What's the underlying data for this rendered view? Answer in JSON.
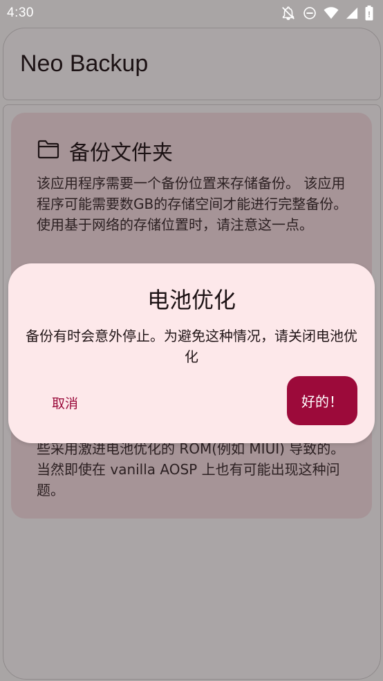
{
  "status_bar": {
    "time": "4:30",
    "icons": [
      "notifications-off-icon",
      "do-not-disturb-icon",
      "wifi-icon",
      "cellular-signal-icon",
      "battery-icon"
    ]
  },
  "app_bar": {
    "title": "Neo Backup"
  },
  "card": {
    "icon": "folder-icon",
    "title": "备份文件夹",
    "description_top": "该应用程序需要一个备份位置来存储备份。 该应用程序可能需要数GB的存储空间才能进行完整备份。 使用基于网络的存储位置时，请注意这一点。",
    "description_bottom": "些采用激进电池优化的 ROM(例如 MIUI) 导致的。当然即使在 vanilla AOSP 上也有可能出现这种问题。"
  },
  "dialog": {
    "title": "电池优化",
    "message": "备份有时会意外停止。为避免这种情况，请关闭电池优化",
    "cancel_label": "取消",
    "confirm_label": "好的！"
  },
  "colors": {
    "dialog_background": "#fde8ea",
    "primary_button": "#9c0a3a",
    "cancel_text": "#9a0a3a",
    "scrim_background": "#a9a5a5",
    "card_background": "#a69497"
  }
}
